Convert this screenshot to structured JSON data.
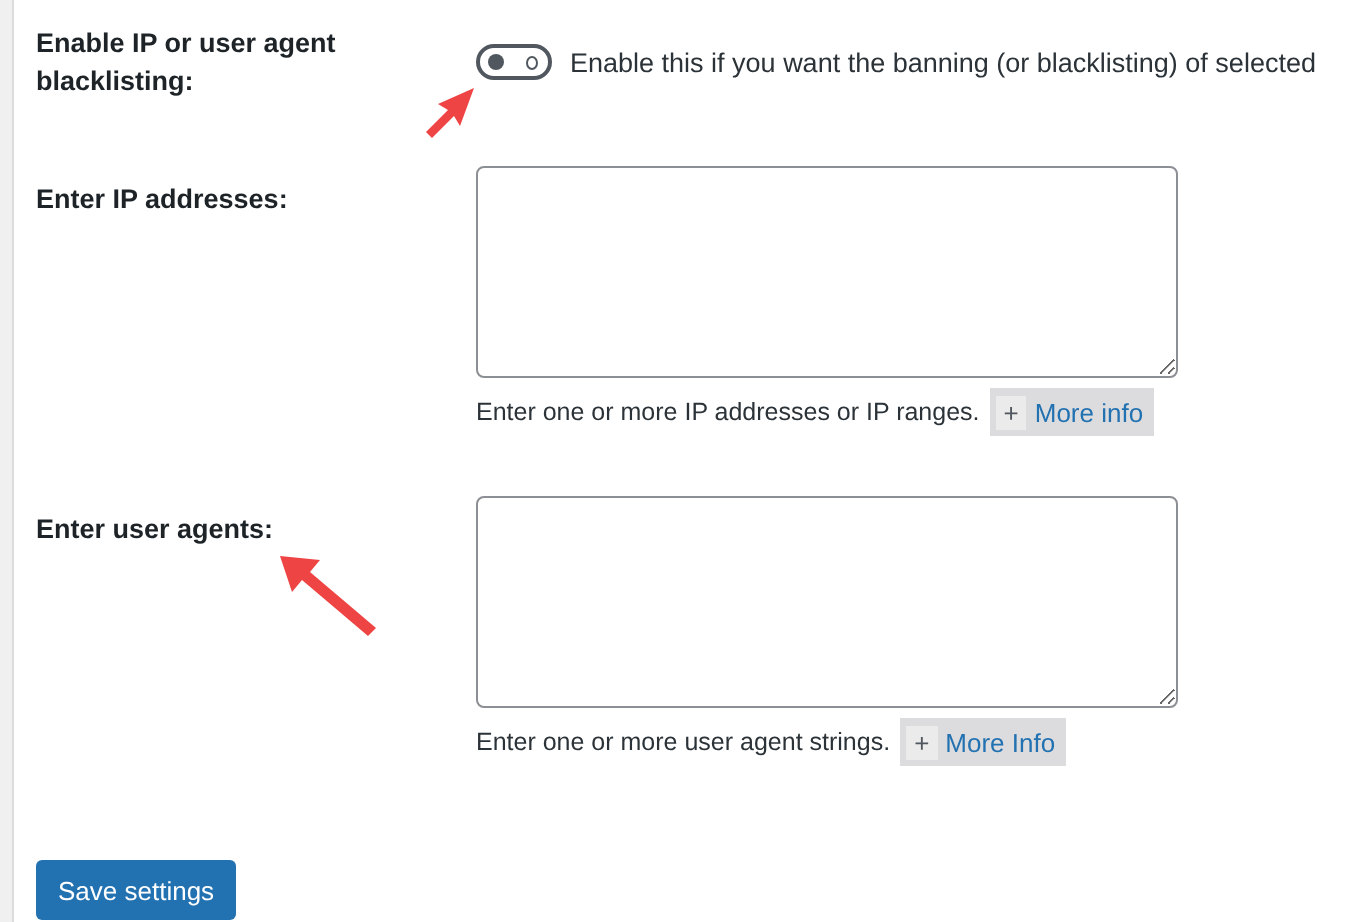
{
  "fields": [
    {
      "kind": "toggle",
      "label": "Enable IP or user agent blacklisting:",
      "on": false,
      "description": "Enable this if you want the banning (or blacklisting) of selected"
    },
    {
      "kind": "textarea",
      "label": "Enter IP addresses:",
      "help": "Enter one or more IP addresses or IP ranges.",
      "more_icon": "+",
      "more_label": "More info"
    },
    {
      "kind": "textarea",
      "label": "Enter user agents:",
      "help": "Enter one or more user agent strings.",
      "more_icon": "+",
      "more_label": "More Info"
    }
  ],
  "save_button": "Save settings"
}
